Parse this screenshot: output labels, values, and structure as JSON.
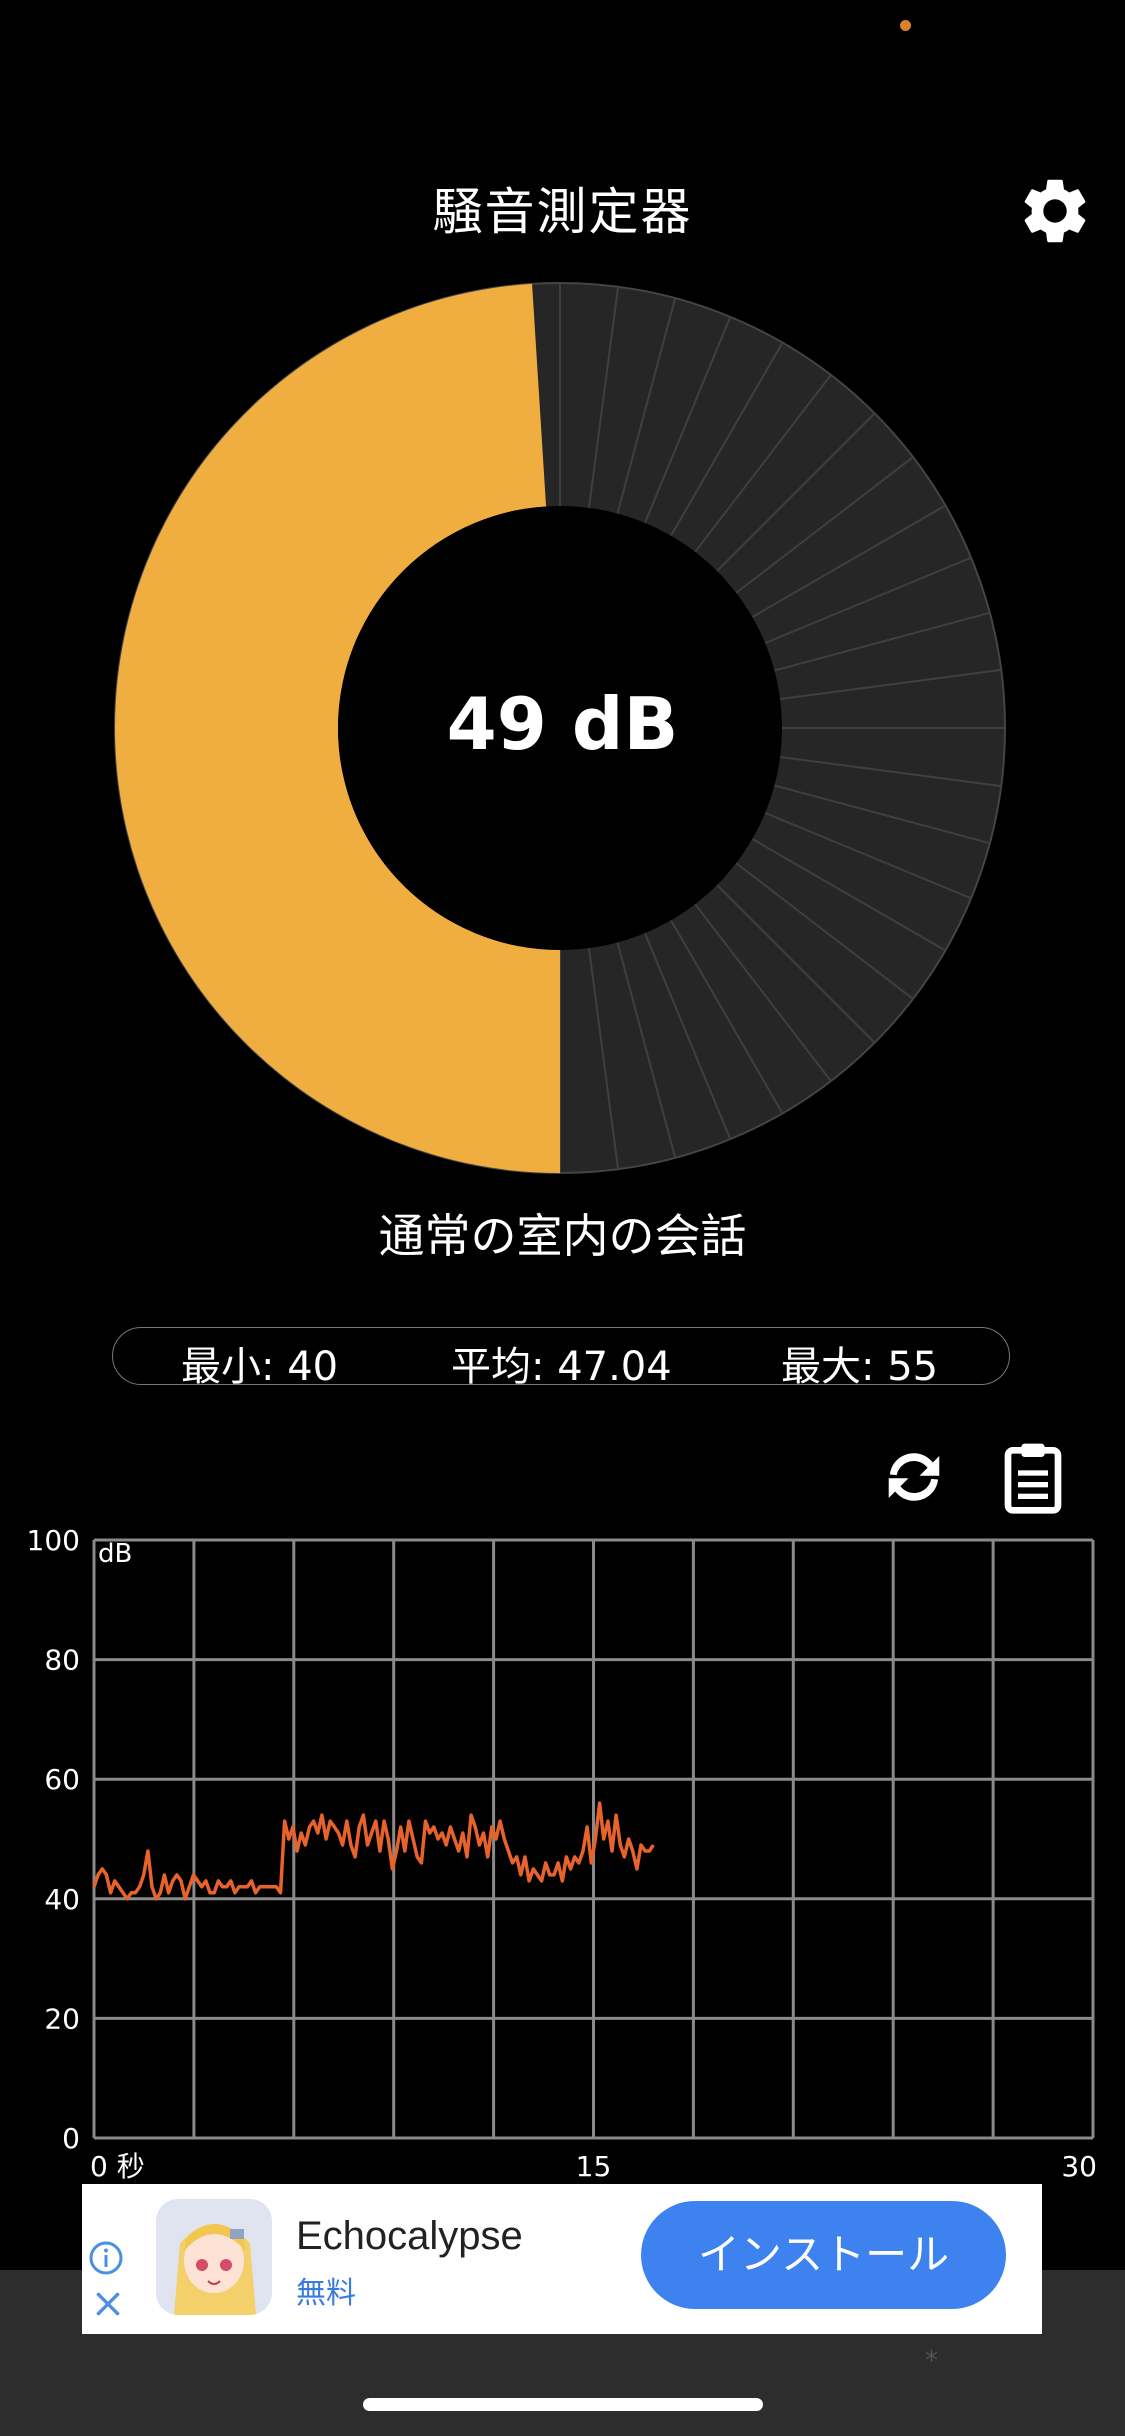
{
  "app": {
    "title": "騒音測定器"
  },
  "gauge": {
    "value_text": "49 dB",
    "value_db": 49,
    "max_db": 100,
    "fill_color": "#F0AE41",
    "track_color": "#262626",
    "segment_lines": 24
  },
  "level_label": "通常の室内の会話",
  "stats": {
    "min": "最小: 40",
    "avg": "平均: 47.04",
    "max": "最大: 55"
  },
  "actions": {
    "reset_icon": "refresh-icon",
    "copy_icon": "clipboard-icon",
    "settings_icon": "gear-icon"
  },
  "chart_data": {
    "type": "line",
    "title": "",
    "xlabel": "",
    "ylabel": "dB",
    "xlim": [
      0,
      30
    ],
    "ylim": [
      0,
      100
    ],
    "x_tick_labels": [
      "0 秒",
      "15",
      "30"
    ],
    "y_tick_labels": [
      "0",
      "20",
      "40",
      "60",
      "80",
      "100"
    ],
    "grid": true,
    "line_color": "#E8622C",
    "series": [
      {
        "values": [
          42,
          44,
          45,
          44,
          41,
          43,
          42,
          41,
          40,
          41,
          41,
          42,
          44,
          48,
          42,
          40,
          41,
          44,
          41,
          43,
          44,
          43,
          40,
          42,
          44,
          43,
          42,
          43,
          41,
          41,
          43,
          42,
          42,
          43,
          41,
          42,
          42,
          42,
          43,
          41,
          42,
          42,
          42,
          42,
          42,
          41,
          53,
          50,
          52,
          48,
          51,
          49,
          52,
          53,
          51,
          54,
          50,
          53,
          52,
          51,
          49,
          53,
          49,
          47,
          52,
          54,
          49,
          51,
          53,
          48,
          53,
          50,
          45,
          48,
          52,
          48,
          53,
          50,
          47,
          46,
          53,
          51,
          52,
          50,
          51,
          49,
          52,
          50,
          48,
          51,
          47,
          54,
          52,
          49,
          51,
          47,
          52,
          50,
          53,
          50,
          48,
          46,
          47,
          44,
          47,
          43,
          45,
          44,
          43,
          46,
          44,
          44,
          46,
          43,
          47,
          45,
          47,
          46,
          48,
          52,
          46,
          50,
          56,
          50,
          53,
          48,
          54,
          49,
          47,
          50,
          48,
          45,
          49,
          48,
          48,
          49
        ]
      }
    ],
    "x_end": 16.8
  },
  "ad": {
    "title": "Echocalypse",
    "subtitle": "無料",
    "button": "インストール",
    "info_icon": "info-icon",
    "close_icon": "close-icon",
    "marker": "*"
  }
}
